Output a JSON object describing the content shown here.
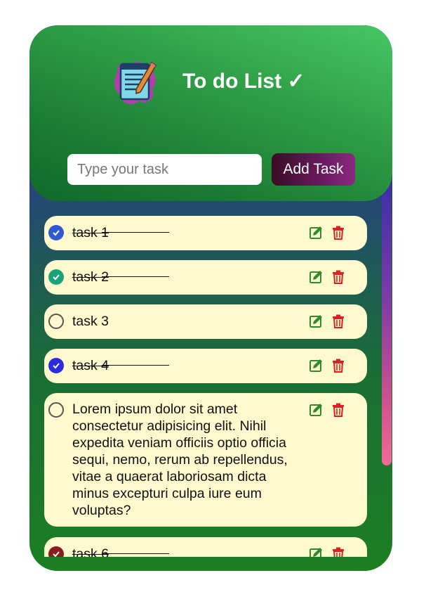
{
  "app": {
    "title": "To do List ✓",
    "logo_icon": "notepad-pencil-icon"
  },
  "input": {
    "placeholder": "Type your task",
    "value": ""
  },
  "add_button": {
    "label": "Add Task"
  },
  "tasks": [
    {
      "text": "task 1",
      "done": true,
      "check_color": "#2f5ad1"
    },
    {
      "text": "task 2",
      "done": true,
      "check_color": "#1aa37a"
    },
    {
      "text": "task 3",
      "done": false
    },
    {
      "text": "task 4",
      "done": true,
      "check_color": "#2a2ae0"
    },
    {
      "text": "Lorem ipsum dolor sit amet consectetur adipisicing elit. Nihil expedita veniam officiis optio officia sequi, nemo, rerum ab repellendus, vitae a quaerat laboriosam dicta minus excepturi culpa iure eum voluptas?",
      "done": false
    },
    {
      "text": "task 6",
      "done": true,
      "check_color": "#8a1c1c"
    }
  ],
  "icons": {
    "edit": "edit-icon",
    "delete": "trash-icon",
    "check": "check-icon"
  },
  "colors": {
    "item_bg": "#fffacd",
    "edit_icon": "#2e8b2e",
    "delete_icon": "#e02020",
    "header_green": "#2e9c45"
  }
}
